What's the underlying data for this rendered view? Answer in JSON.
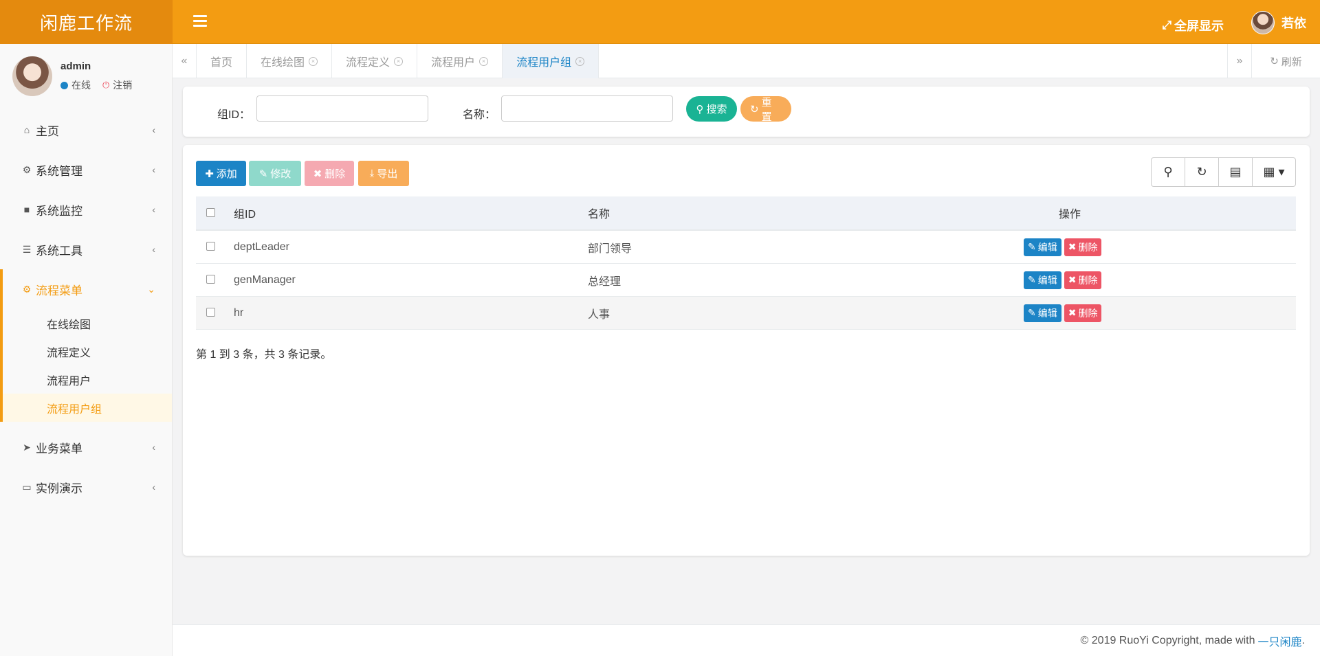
{
  "app": {
    "title": "闲鹿工作流"
  },
  "topbar": {
    "fullscreen_label": "全屏显示",
    "user_name": "若依"
  },
  "sidebar": {
    "user": {
      "name": "admin",
      "status": "在线",
      "logout": "注销"
    },
    "menu": [
      {
        "label": "主页",
        "icon": "home-icon"
      },
      {
        "label": "系统管理",
        "icon": "gear-icon"
      },
      {
        "label": "系统监控",
        "icon": "video-camera-icon"
      },
      {
        "label": "系统工具",
        "icon": "bars-icon"
      }
    ],
    "flow_menu": {
      "label": "流程菜单",
      "icon": "cogs-icon",
      "children": [
        "在线绘图",
        "流程定义",
        "流程用户",
        "流程用户组"
      ]
    },
    "menu_after": [
      {
        "label": "业务菜单",
        "icon": "paper-plane-icon"
      },
      {
        "label": "实例演示",
        "icon": "desktop-icon"
      }
    ]
  },
  "tabs": {
    "items": [
      "首页",
      "在线绘图",
      "流程定义",
      "流程用户",
      "流程用户组"
    ],
    "refresh_label": "刷新"
  },
  "search": {
    "group_id_label": "组ID：",
    "group_id_value": "",
    "name_label": "名称：",
    "name_value": "",
    "search_button": "搜索",
    "reset_button": "重置"
  },
  "toolbar": {
    "add": "添加",
    "edit": "修改",
    "delete": "删除",
    "export": "导出"
  },
  "table": {
    "columns": [
      "组ID",
      "名称",
      "操作"
    ],
    "rows": [
      {
        "id": "deptLeader",
        "name": "部门领导"
      },
      {
        "id": "genManager",
        "name": "总经理"
      },
      {
        "id": "hr",
        "name": "人事"
      }
    ],
    "edit_label": "编辑",
    "delete_label": "删除"
  },
  "pagination": {
    "info": "第 1 到 3 条，共 3 条记录。"
  },
  "footer": {
    "copyright": "© 2019 RuoYi Copyright, made with",
    "link": "一只闲鹿",
    "suffix": "."
  },
  "colors": {
    "brand": "#f39c12",
    "logo_bg": "#e48a0e",
    "primary": "#1c84c6",
    "success": "#1ab394",
    "danger": "#ed5565",
    "warning": "#f8ac59"
  }
}
